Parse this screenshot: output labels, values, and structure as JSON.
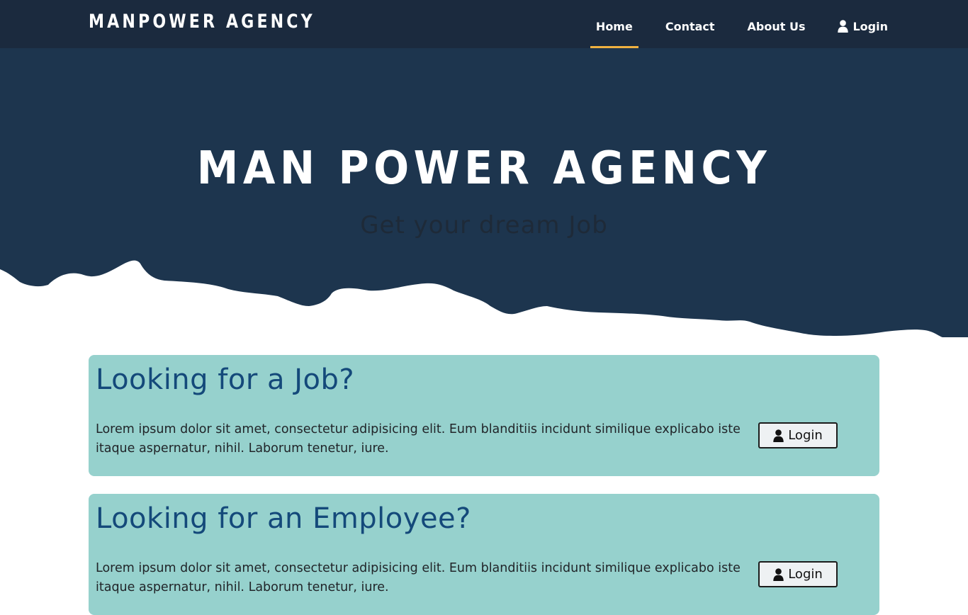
{
  "navbar": {
    "brand": "MANPOWER AGENCY",
    "items": [
      {
        "label": "Home",
        "active": true
      },
      {
        "label": "Contact"
      },
      {
        "label": "About Us"
      },
      {
        "label": "Login",
        "icon": "user-icon"
      }
    ],
    "accent": "#f0b140"
  },
  "hero": {
    "title": "MAN POWER AGENCY",
    "subtitle": "Get your dream Job"
  },
  "cards": [
    {
      "heading": "Looking for a Job?",
      "text": "Lorem ipsum dolor sit amet, consectetur adipisicing elit. Eum blanditiis incidunt similique explicabo iste itaque aspernatur, nihil. Laborum tenetur, iure.",
      "button": "Login",
      "button_icon": "user-icon"
    },
    {
      "heading": "Looking for an Employee?",
      "text": "Lorem ipsum dolor sit amet, consectetur adipisicing elit. Eum blanditiis incidunt similique explicabo iste itaque aspernatur, nihil. Laborum tenetur, iure.",
      "button": "Login",
      "button_icon": "user-icon"
    }
  ],
  "colors": {
    "navbar_bg": "#1b2a3e",
    "hero_bg": "#1d354e",
    "card_bg": "#96d1cd",
    "heading": "#14497a"
  }
}
